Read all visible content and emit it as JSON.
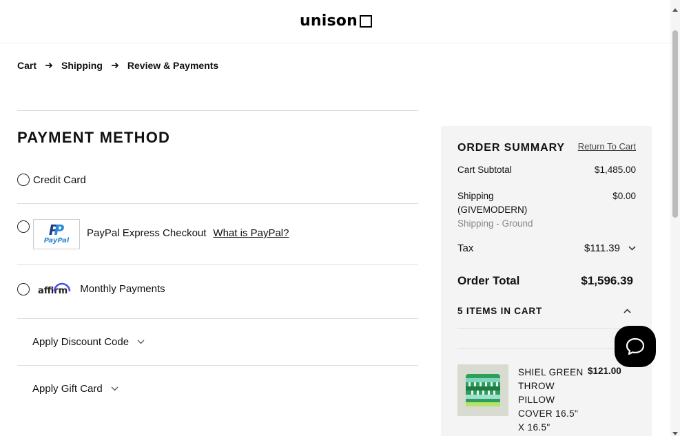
{
  "header": {
    "logo_text": "unison"
  },
  "breadcrumb": [
    {
      "label": "Cart"
    },
    {
      "label": "Shipping"
    },
    {
      "label": "Review & Payments"
    }
  ],
  "payment": {
    "title": "PAYMENT METHOD",
    "options": {
      "credit_card": {
        "label": "Credit Card"
      },
      "paypal": {
        "label": "PayPal Express Checkout",
        "link": "What is PayPal?",
        "logo_text": "PayPal"
      },
      "affirm": {
        "label": "Monthly Payments",
        "logo_text": "affirm"
      }
    },
    "discount_label": "Apply Discount Code",
    "gift_card_label": "Apply Gift Card"
  },
  "summary": {
    "title": "ORDER SUMMARY",
    "return_link": "Return To Cart",
    "subtotal_label": "Cart Subtotal",
    "subtotal_value": "$1,485.00",
    "shipping_label": "Shipping",
    "shipping_code": "(GIVEMODERN)",
    "shipping_value": "$0.00",
    "shipping_method": "Shipping - Ground",
    "tax_label": "Tax",
    "tax_value": "$111.39",
    "total_label": "Order Total",
    "total_value": "$1,596.39",
    "items_label": "5 ITEMS IN CART",
    "items": [
      {
        "name": "SHIEL GREEN THROW PILLOW COVER 16.5\" X 16.5\"",
        "price": "$121.00"
      }
    ]
  },
  "icons": {
    "arrow": "arrow-right-icon",
    "chevron_down": "chevron-down-icon",
    "chevron_up": "chevron-up-icon",
    "chat": "chat-bubble-icon"
  },
  "colors": {
    "paypal_dark": "#1b3c86",
    "paypal_light": "#2a8bd8",
    "panel_bg": "#f4f4f4"
  }
}
